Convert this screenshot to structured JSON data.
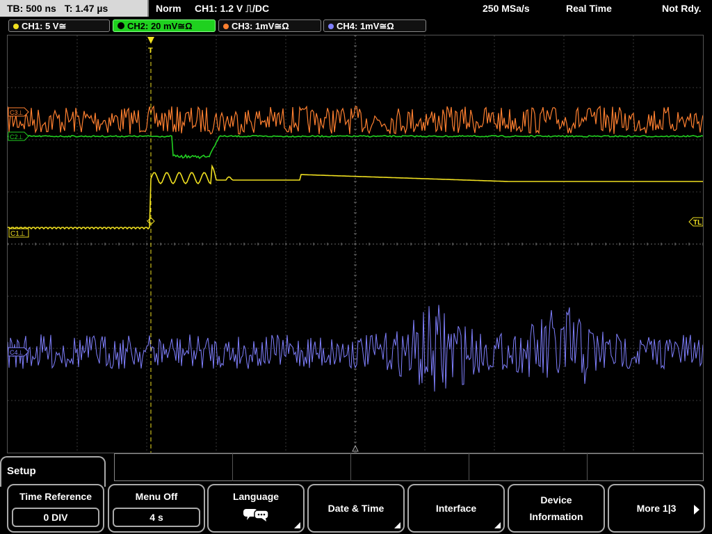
{
  "status": {
    "timebase": "TB: 500 ns",
    "trigger_time": "T: 1.47 µs",
    "mode": "Norm",
    "trigger_setting": "CH1: 1.2 V ⎍/DC",
    "sample_rate": "250 MSa/s",
    "acq_mode": "Real Time",
    "ready_state": "Not Rdy."
  },
  "channels": [
    {
      "label": "CH1: 5 V≅",
      "color": "#f0e020"
    },
    {
      "label": "CH2: 20 mV≅Ω",
      "color": "#22d022"
    },
    {
      "label": "CH3: 1mV≅Ω",
      "color": "#ff8030"
    },
    {
      "label": "CH4: 1mV≅Ω",
      "color": "#8080ff"
    }
  ],
  "markers": {
    "c1": "C1⊥",
    "c2": "C2⊥",
    "c3": "C3⊥",
    "c4": "C4⊥",
    "trigger_level": "TL",
    "trigger_pos": "T"
  },
  "menu": {
    "title": "Setup",
    "softkeys": [
      {
        "label": "Time Reference",
        "value": "0 DIV"
      },
      {
        "label": "Menu Off",
        "value": "4 s"
      },
      {
        "label": "Language",
        "icon": "speech-bubbles-icon"
      },
      {
        "label": "Date & Time"
      },
      {
        "label": "Interface"
      },
      {
        "label_line1": "Device",
        "label_line2": "Information"
      },
      {
        "label": "More 1|3"
      }
    ]
  }
}
